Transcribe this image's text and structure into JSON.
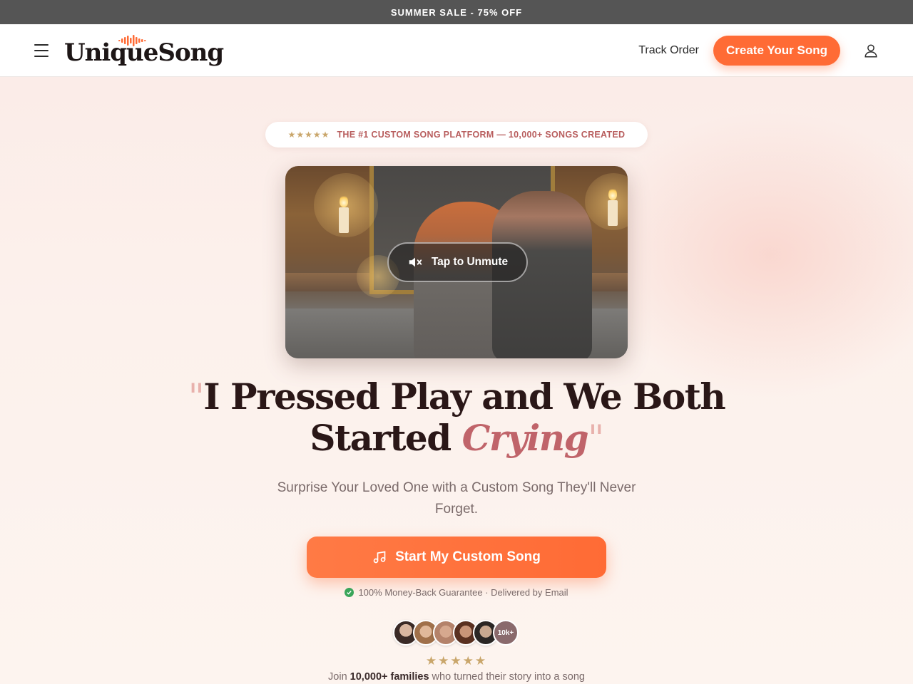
{
  "topbar": {
    "text": "SUMMER SALE - 75% OFF"
  },
  "header": {
    "logo_text": "UniqueSong",
    "track_order": "Track Order",
    "create_button": "Create Your Song"
  },
  "hero": {
    "badge_stars": "★★★★★",
    "badge_text": "THE #1 CUSTOM SONG PLATFORM — 10,000+ SONGS CREATED",
    "unmute_label": "Tap to Unmute",
    "headline_open_quote": "\"",
    "headline_line1": "I Pressed Play and We Both",
    "headline_line2_plain": "Started ",
    "headline_accent": "Crying",
    "headline_close_quote": "\"",
    "subtitle": "Surprise Your Loved One with a Custom Song They'll Never Forget.",
    "cta_label": "Start My Custom Song",
    "guarantee": "100% Money-Back Guarantee · Delivered by Email",
    "avatar_count": "10k+",
    "rating_stars": "★★★★★",
    "join_prefix": "Join ",
    "join_bold": "10,000+ families",
    "join_suffix": " who turned their story into a song"
  },
  "colors": {
    "accent": "#ff6b35",
    "badge_text": "#b85d5d",
    "star": "#c9a66b",
    "headline_accent": "#c0646a",
    "topbar": "#555555"
  },
  "icons": [
    "hamburger-icon",
    "sound-wave-icon",
    "user-icon",
    "muted-speaker-icon",
    "music-note-icon",
    "check-circle-icon",
    "star-icon"
  ]
}
